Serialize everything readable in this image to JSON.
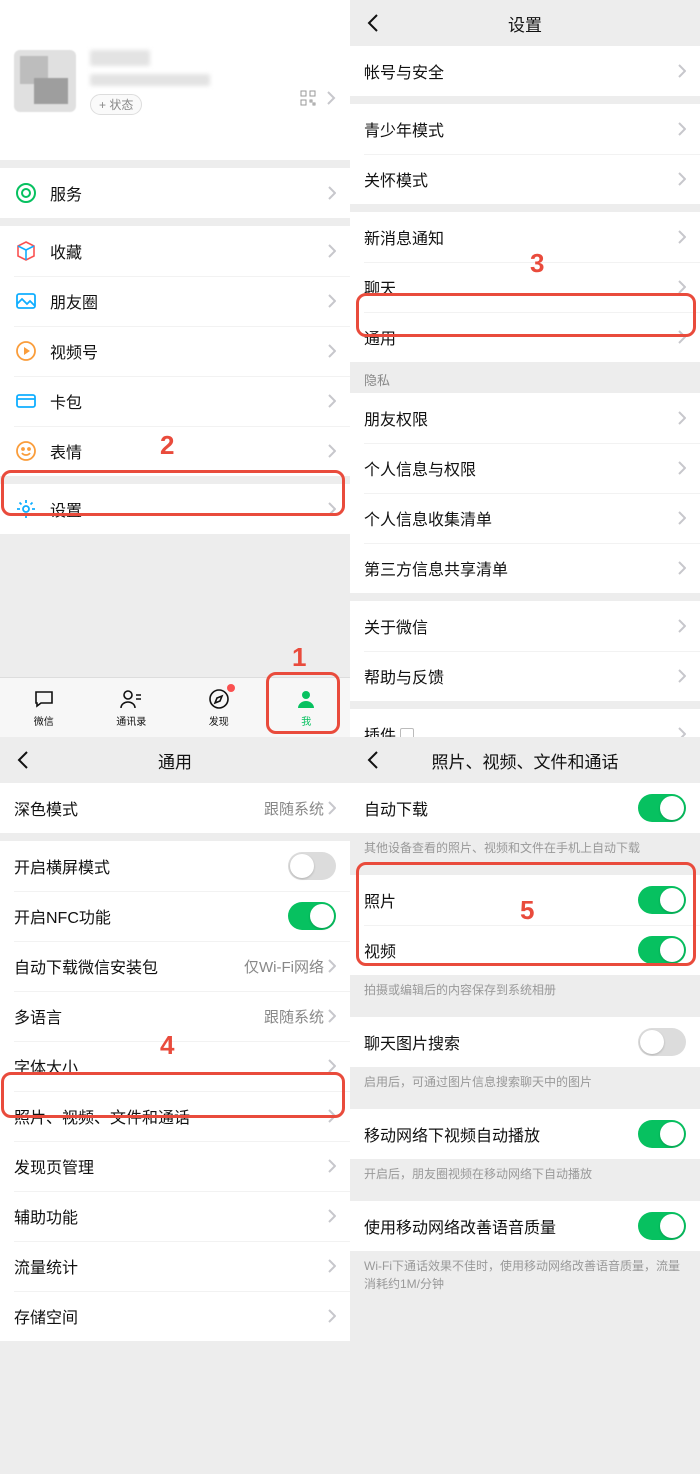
{
  "colors": {
    "accent": "#07c160",
    "highlight": "#e94b3c"
  },
  "annotations": {
    "n1": "1",
    "n2": "2",
    "n3": "3",
    "n4": "4",
    "n5": "5"
  },
  "q1": {
    "status_chip": "+ 状态",
    "menu": {
      "services": "服务",
      "favorites": "收藏",
      "moments": "朋友圈",
      "channels": "视频号",
      "cards": "卡包",
      "stickers": "表情",
      "settings": "设置"
    },
    "tabs": {
      "chat": "微信",
      "contacts": "通讯录",
      "discover": "发现",
      "me": "我"
    }
  },
  "q2": {
    "title": "设置",
    "items": {
      "account": "帐号与安全",
      "teen": "青少年模式",
      "care": "关怀模式",
      "notif": "新消息通知",
      "chat": "聊天",
      "general": "通用",
      "privacy_header": "隐私",
      "friend_perm": "朋友权限",
      "personal_perm": "个人信息与权限",
      "collect_list": "个人信息收集清单",
      "share_list": "第三方信息共享清单",
      "about": "关于微信",
      "help": "帮助与反馈",
      "plugins": "插件"
    }
  },
  "q3": {
    "title": "通用",
    "items": {
      "dark": "深色模式",
      "dark_val": "跟随系统",
      "landscape": "开启横屏模式",
      "nfc": "开启NFC功能",
      "autodl": "自动下载微信安装包",
      "autodl_val": "仅Wi-Fi网络",
      "lang": "多语言",
      "lang_val": "跟随系统",
      "font": "字体大小",
      "media": "照片、视频、文件和通话",
      "discover_mgmt": "发现页管理",
      "a11y": "辅助功能",
      "traffic": "流量统计",
      "storage": "存储空间"
    },
    "toggles": {
      "landscape": false,
      "nfc": true
    }
  },
  "q4": {
    "title": "照片、视频、文件和通话",
    "items": {
      "autodl": "自动下载",
      "autodl_note": "其他设备查看的照片、视频和文件在手机上自动下载",
      "photo": "照片",
      "video": "视频",
      "save_note": "拍摄或编辑后的内容保存到系统相册",
      "img_search": "聊天图片搜索",
      "img_search_note": "启用后，可通过图片信息搜索聊天中的图片",
      "cell_autoplay": "移动网络下视频自动播放",
      "cell_autoplay_note": "开启后，朋友圈视频在移动网络下自动播放",
      "cell_voice": "使用移动网络改善语音质量",
      "cell_voice_note": "Wi-Fi下通话效果不佳时，使用移动网络改善语音质量，流量消耗约1M/分钟"
    },
    "toggles": {
      "autodl": true,
      "photo": true,
      "video": true,
      "img_search": false,
      "cell_autoplay": true,
      "cell_voice": true
    }
  }
}
